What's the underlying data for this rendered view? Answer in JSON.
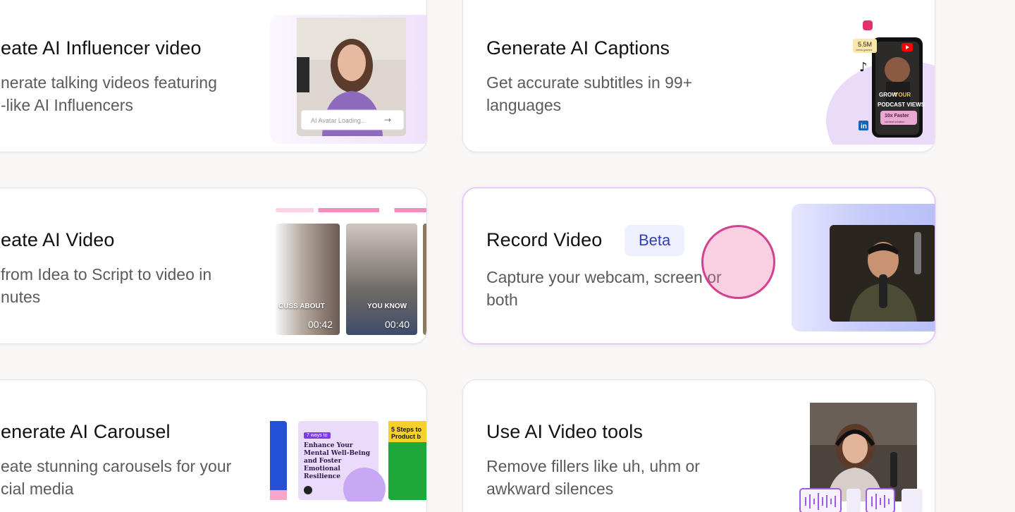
{
  "cards": [
    {
      "title": "eate AI Influencer video",
      "description": "nerate talking videos featuring\n-like AI Influencers",
      "thumb_input_placeholder": "AI Avatar Loading..."
    },
    {
      "title": "Generate AI Captions",
      "description": "Get accurate subtitles in 99+\nlanguages",
      "thumb_stat": "5.5M",
      "thumb_stat_sub": "views gained",
      "thumb_headline_1": "GROW",
      "thumb_headline_highlight": "YOUR",
      "thumb_headline_2": "PODCAST VIEWS",
      "thumb_pill": "10x Faster",
      "thumb_pill_sub": "content creation"
    },
    {
      "title": "eate AI Video",
      "description": " from Idea to Script to video in\nnutes",
      "clips": [
        {
          "caption": "CUSS ABOUT",
          "duration": "00:42"
        },
        {
          "caption": "YOU KNOW",
          "duration": "00:40"
        }
      ]
    },
    {
      "title": "Record Video",
      "badge": "Beta",
      "description": "Capture your webcam, screen or\nboth"
    },
    {
      "title": "enerate AI Carousel",
      "description": "eate stunning carousels for your\ncial media",
      "slide_tag": "7 ways to",
      "slide_title": "Enhance Your Mental Well-Being and Foster Emotional Resilience",
      "slide_title_2": "5 Steps to Product b"
    },
    {
      "title": "Use AI Video tools",
      "description": "Remove fillers like uh, uhm or\nawkward silences"
    }
  ],
  "colors": {
    "background": "#f8f7f6",
    "badge_bg": "#eef0fd",
    "badge_text": "#2f3fb8",
    "accent_purple": "#8b5cf6",
    "cursor": "#d4418e"
  }
}
